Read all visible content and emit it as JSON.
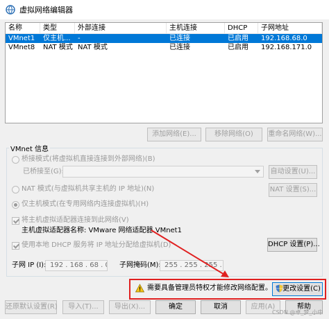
{
  "window": {
    "title": "虚拟网络编辑器",
    "icon": "network-editor-icon"
  },
  "list": {
    "columns": [
      "名称",
      "类型",
      "外部连接",
      "主机连接",
      "DHCP",
      "子网地址"
    ],
    "rows": [
      {
        "name": "VMnet1",
        "type": "仅主机...",
        "external": "-",
        "host": "已连接",
        "dhcp": "已启用",
        "subnet": "192.168.68.0",
        "selected": true
      },
      {
        "name": "VMnet8",
        "type": "NAT 模式",
        "external": "NAT 模式",
        "host": "已连接",
        "dhcp": "已启用",
        "subnet": "192.168.171.0",
        "selected": false
      }
    ]
  },
  "list_buttons": {
    "add": "添加网络(E)...",
    "remove": "移除网络(O)",
    "rename": "重命名网络(W)..."
  },
  "vmnet_info": {
    "label": "VMnet 信息",
    "bridged": "桥接模式(将虚拟机直接连接到外部网络)(B)",
    "bridged_to": "已桥接至(G):",
    "auto_settings": "自动设置(U)...",
    "nat": "NAT 模式(与虚拟机共享主机的 IP 地址)(N)",
    "nat_settings": "NAT 设置(S)...",
    "host_only": "仅主机模式(在专用网络内连接虚拟机)(H)",
    "connect_adapter": "将主机虚拟适配器连接到此网络(V)",
    "adapter_name": "主机虚拟适配器名称: VMware 网络适配器 VMnet1",
    "use_dhcp": "使用本地 DHCP 服务将 IP 地址分配给虚拟机(D)",
    "dhcp_settings": "DHCP 设置(P)...",
    "subnet_ip_label": "子网 IP (I):",
    "subnet_ip": "192 . 168 . 68  .  0",
    "subnet_mask_label": "子网掩码(M):",
    "subnet_mask": "255 . 255 . 255 . 0"
  },
  "admin": {
    "message": "需要具备管理员特权才能修改网络配置。",
    "change_settings": "更改设置(C)"
  },
  "footer": {
    "restore": "还原默认设置(R)",
    "import": "导入(T)...",
    "export": "导出(X)...",
    "ok": "确定",
    "cancel": "取消",
    "apply": "应用(A)",
    "help": "帮助"
  },
  "watermark": "CSDN @卓_梦_小中",
  "colors": {
    "selection": "#0078d7",
    "annotation": "#e02020"
  }
}
